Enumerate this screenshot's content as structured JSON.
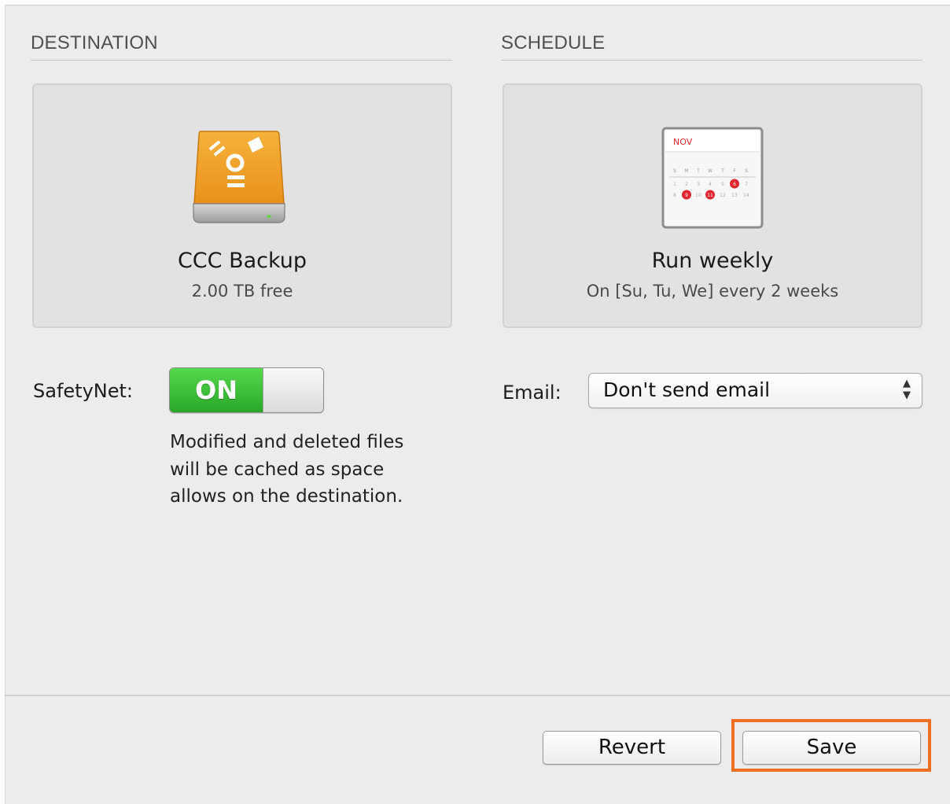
{
  "destination": {
    "section_title": "DESTINATION",
    "volume_name": "CCC Backup",
    "free_space": "2.00 TB free",
    "icon": "firewire-drive-icon"
  },
  "schedule": {
    "section_title": "SCHEDULE",
    "title": "Run weekly",
    "detail": "On [Su, Tu, We] every 2 weeks",
    "icon": "calendar-icon",
    "calendar": {
      "month": "NOV",
      "weekdays": [
        "S",
        "M",
        "T",
        "W",
        "T",
        "F",
        "S"
      ],
      "row1": [
        "1",
        "2",
        "3",
        "4",
        "5",
        "6",
        "7"
      ],
      "row2": [
        "8",
        "9",
        "10",
        "11",
        "12",
        "13",
        "14"
      ],
      "highlighted_days": [
        "6",
        "9",
        "11"
      ]
    }
  },
  "safetynet": {
    "label": "SafetyNet:",
    "toggle_state": "ON",
    "description_lines": [
      "Modified and deleted files",
      "will be cached as space",
      "allows on the destination."
    ]
  },
  "email": {
    "label": "Email:",
    "selected": "Don't send email"
  },
  "footer": {
    "revert_label": "Revert",
    "save_label": "Save"
  },
  "colors": {
    "toggle_on": "#35b535",
    "highlight_border": "#f07023",
    "drive_orange": "#f0a22a",
    "calendar_red": "#e0252f"
  }
}
